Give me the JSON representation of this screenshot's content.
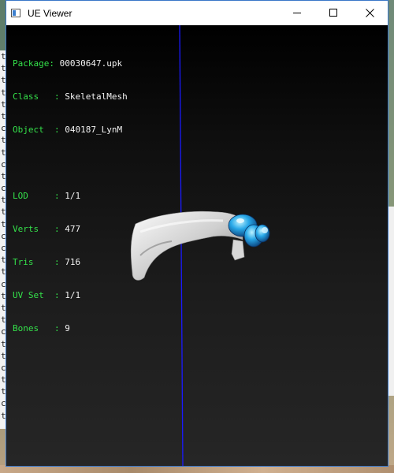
{
  "window": {
    "title": "UE Viewer",
    "controls": {
      "minimize": "—",
      "maximize": "☐",
      "close": "✕"
    }
  },
  "info_block_1": [
    {
      "label": "Package: ",
      "value": "00030647.upk"
    },
    {
      "label": "Class   : ",
      "value": "SkeletalMesh"
    },
    {
      "label": "Object  : ",
      "value": "040187_LynM"
    }
  ],
  "info_block_2": [
    {
      "label": "LOD     : ",
      "value": "1/1"
    },
    {
      "label": "Verts   : ",
      "value": "477"
    },
    {
      "label": "Tris    : ",
      "value": "716"
    },
    {
      "label": "UV Set  : ",
      "value": "1/1"
    },
    {
      "label": "Bones   : ",
      "value": "9"
    }
  ],
  "behind_window_chars": [
    "t",
    "t",
    "t",
    "t",
    "t",
    "t",
    "c",
    "t",
    "t",
    "c",
    "t",
    "c",
    "t",
    "t",
    "t",
    "c",
    "c",
    "t",
    "t",
    "c",
    "t",
    "t",
    "t",
    "c",
    "t",
    "t",
    "c",
    "t",
    "t",
    "c",
    "t"
  ],
  "colors": {
    "label": "#34e04a",
    "value": "#f2f2f2",
    "axis": "#1a1aff",
    "accent": "#3a77c8"
  }
}
